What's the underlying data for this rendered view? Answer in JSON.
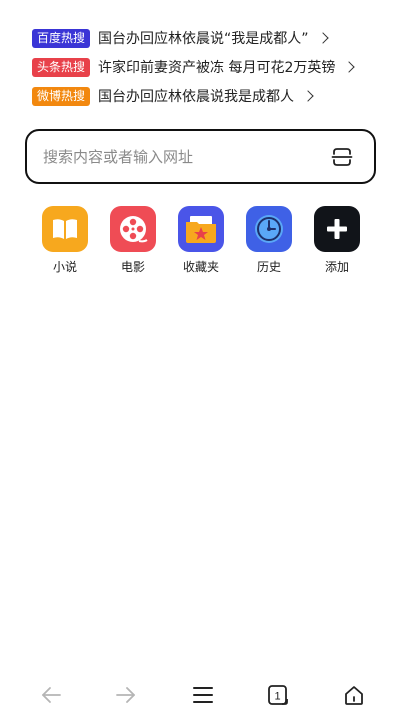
{
  "hot_searches": [
    {
      "badge": "百度热搜",
      "badge_color": "#3a35d6",
      "text": "国台办回应林依晨说“我是成都人”"
    },
    {
      "badge": "头条热搜",
      "badge_color": "#e8414a",
      "text": "许家印前妻资产被冻 每月可花2万英镑"
    },
    {
      "badge": "微博热搜",
      "badge_color": "#f2880f",
      "text": "国台办回应林依晨说我是成都人"
    }
  ],
  "search": {
    "placeholder": "搜索内容或者输入网址",
    "icon": "scan-icon"
  },
  "shortcuts": [
    {
      "label": "小说",
      "icon": "book-icon",
      "color": "#f7a81e"
    },
    {
      "label": "电影",
      "icon": "film-reel-icon",
      "color": "#ef4c55"
    },
    {
      "label": "收藏夹",
      "icon": "folder-star-icon",
      "color": "#4a55e8"
    },
    {
      "label": "历史",
      "icon": "clock-icon",
      "color": "#3f61e6"
    },
    {
      "label": "添加",
      "icon": "plus-icon",
      "color": "#111419"
    }
  ],
  "bottom_nav": {
    "back_icon": "arrow-left-icon",
    "forward_icon": "arrow-right-icon",
    "menu_icon": "menu-icon",
    "tabs_count": "1",
    "home_icon": "home-icon"
  }
}
